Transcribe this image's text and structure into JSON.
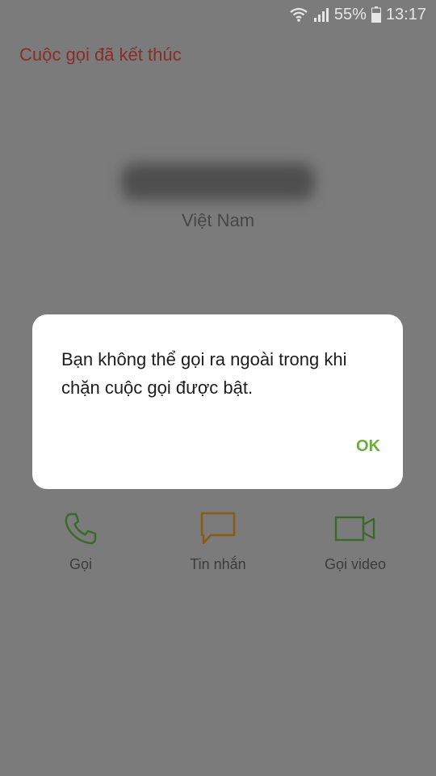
{
  "status_bar": {
    "battery_percent": "55%",
    "time": "13:17"
  },
  "call_ended_label": "Cuộc gọi đã kết thúc",
  "country": "Việt Nam",
  "dialog": {
    "message": "Bạn không thể gọi ra ngoài trong khi chặn cuộc gọi được bật.",
    "ok_label": "OK"
  },
  "actions": [
    {
      "label": "Gọi",
      "icon": "phone-icon",
      "color": "#3a6a2a"
    },
    {
      "label": "Tin nhắn",
      "icon": "message-icon",
      "color": "#8a5a10"
    },
    {
      "label": "Gọi video",
      "icon": "video-icon",
      "color": "#3a6a2a"
    }
  ],
  "colors": {
    "overlay": "#7b7b7b",
    "accent_ok": "#6cab3d",
    "call_ended": "#8c2b2b"
  }
}
